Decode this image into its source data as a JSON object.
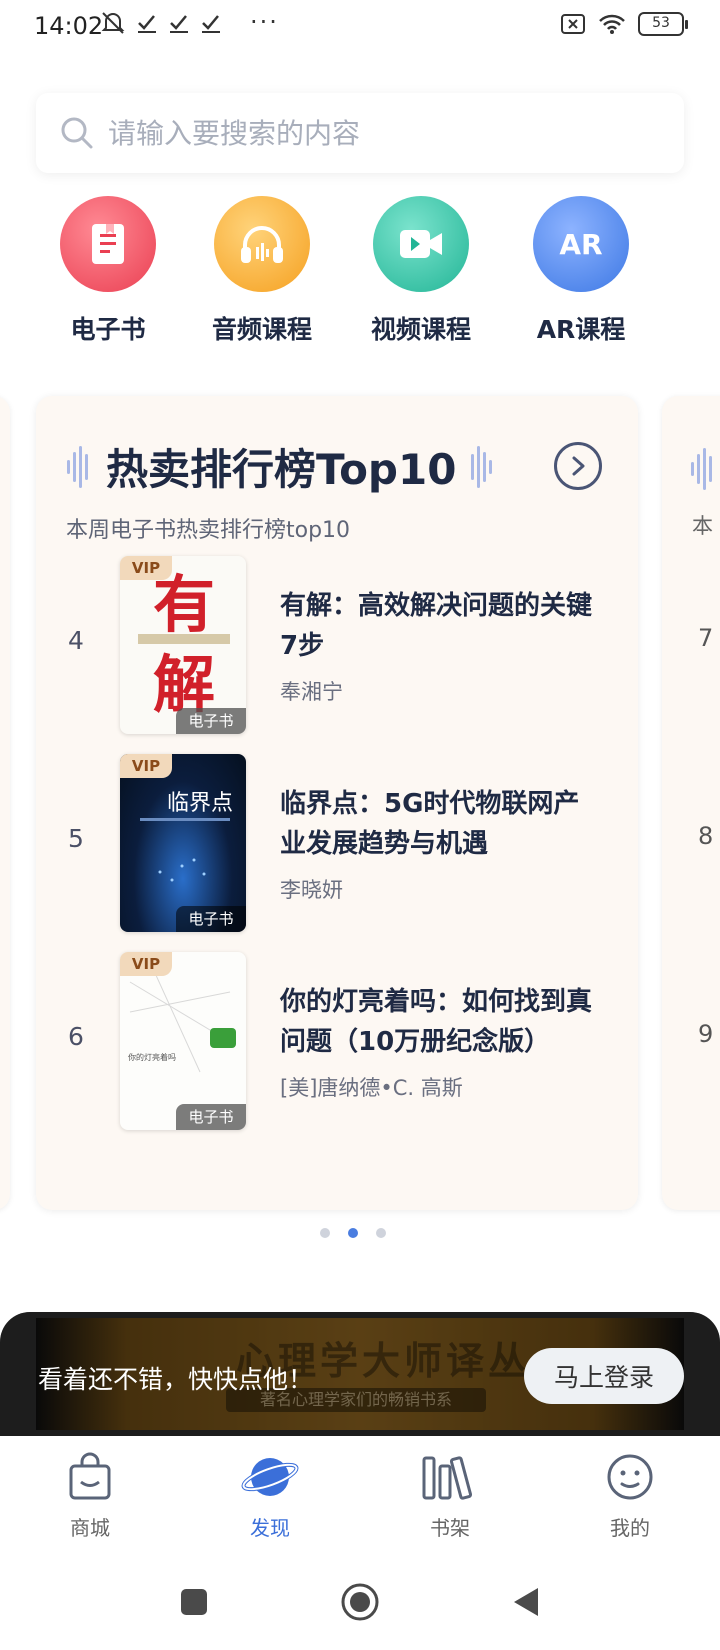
{
  "status": {
    "time": "14:02",
    "battery": "53"
  },
  "search": {
    "placeholder": "请输入要搜索的内容"
  },
  "categories": [
    {
      "label": "电子书",
      "icon": "ebook-icon",
      "color": "#f0505e"
    },
    {
      "label": "音频课程",
      "icon": "headphones-icon",
      "color": "#f6a92c"
    },
    {
      "label": "视频课程",
      "icon": "video-icon",
      "color": "#2fc1a4"
    },
    {
      "label": "AR课程",
      "icon": "ar-icon",
      "color": "#4a86e8"
    }
  ],
  "ranking": {
    "title": "热卖排行榜Top10",
    "subtitle": "本周电子书热卖排行榜top10",
    "subtitle_peek": "本",
    "books": [
      {
        "rank": "4",
        "title": "有解：高效解决问题的关键7步",
        "author": "奉湘宁",
        "vip": "VIP",
        "tag": "电子书",
        "cover_text": "有解"
      },
      {
        "rank": "5",
        "title": "临界点：5G时代物联网产业发展趋势与机遇",
        "author": "李晓妍",
        "vip": "VIP",
        "tag": "电子书",
        "cover_text": "临界点"
      },
      {
        "rank": "6",
        "title": "你的灯亮着吗：如何找到真问题（10万册纪念版）",
        "author": "[美]唐纳德•C. 高斯",
        "vip": "VIP",
        "tag": "电子书",
        "cover_text": "你的灯亮着吗"
      }
    ],
    "peek_ranks": [
      "7",
      "8",
      "9"
    ],
    "pager": {
      "count": 3,
      "active": 2
    }
  },
  "banner": {
    "headline": "心理学大师译丛",
    "tagline": "著名心理学家们的畅销书系",
    "prompt": "看着还不错，快快点他！",
    "login_label": "马上登录"
  },
  "bottom_nav": [
    {
      "label": "商城",
      "icon": "shopping-bag-icon",
      "active": false
    },
    {
      "label": "发现",
      "icon": "planet-icon",
      "active": true
    },
    {
      "label": "书架",
      "icon": "bookshelf-icon",
      "active": false
    },
    {
      "label": "我的",
      "icon": "face-icon",
      "active": false
    }
  ]
}
